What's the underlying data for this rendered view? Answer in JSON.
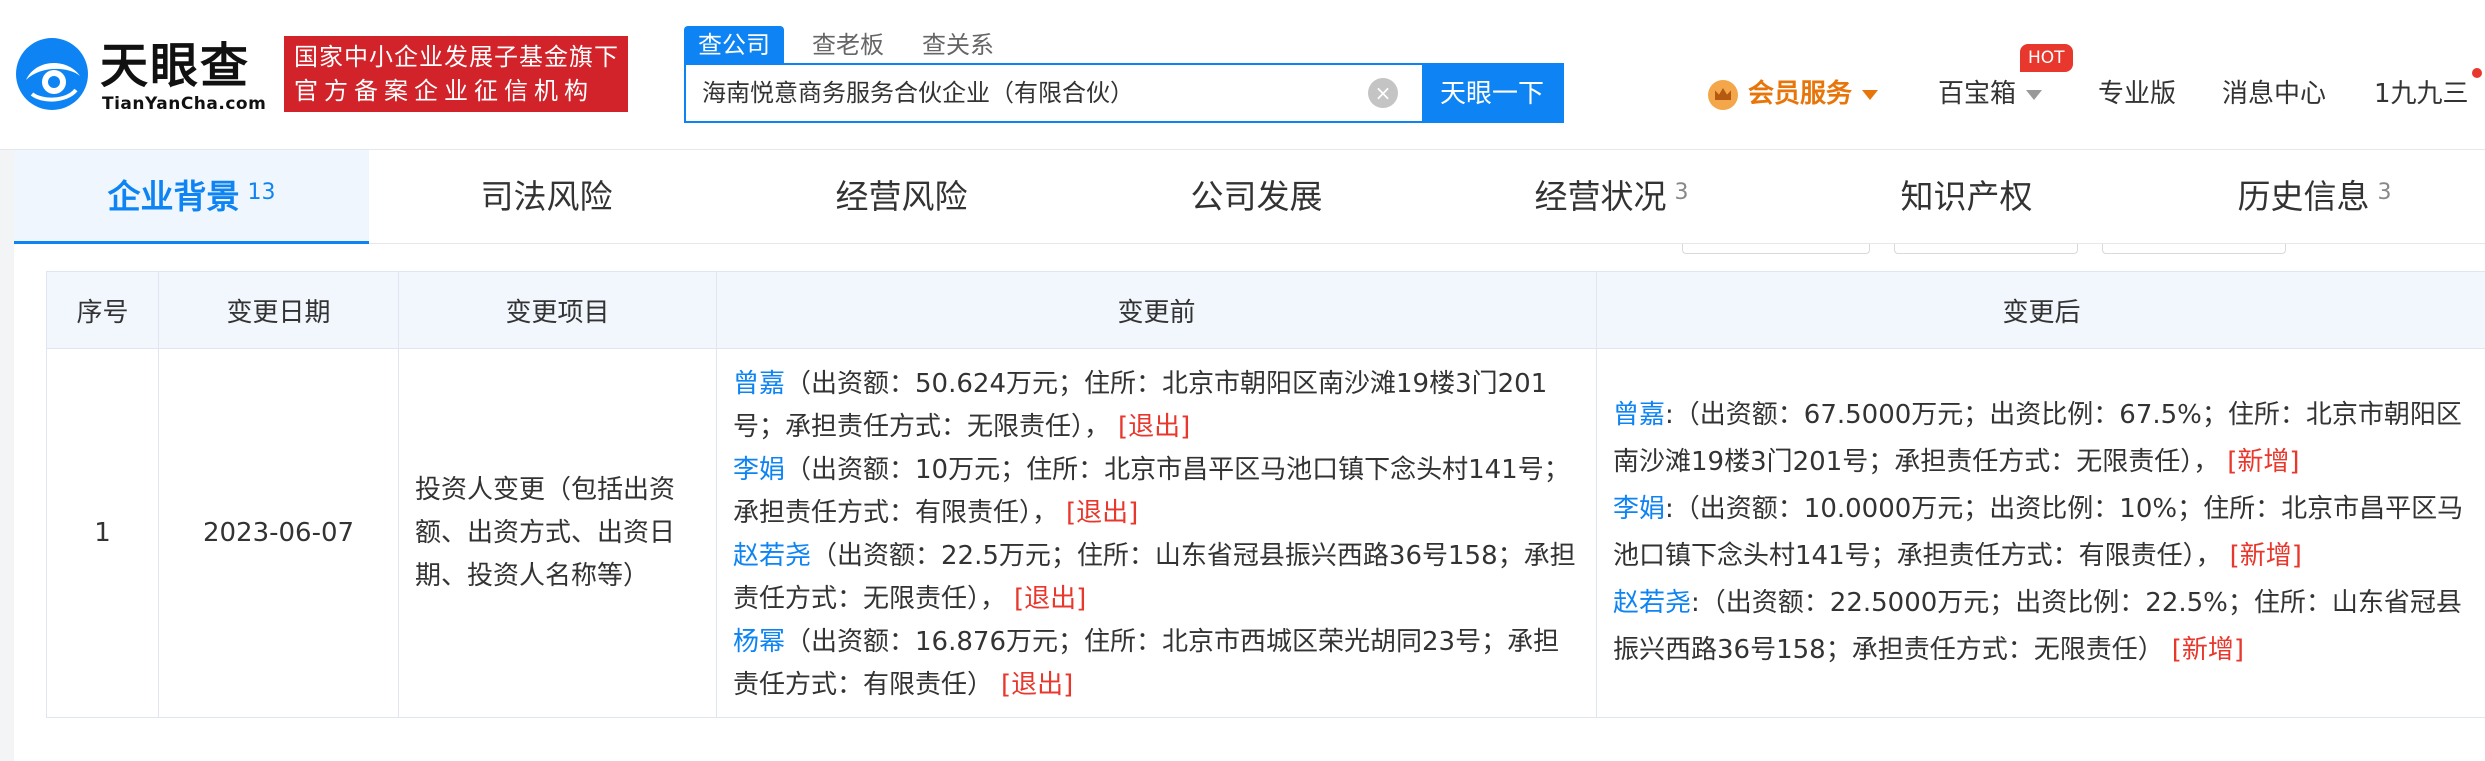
{
  "header": {
    "logo_text": "天眼查",
    "logo_sub": "TianYanCha.com",
    "badge_line1": "国家中小企业发展子基金旗下",
    "badge_line2": "官方备案企业征信机构",
    "search_tabs": [
      "查公司",
      "查老板",
      "查关系"
    ],
    "search_value": "海南悦意商务服务合伙企业（有限合伙）",
    "search_button": "天眼一下",
    "nav": {
      "vip": "会员服务",
      "treasure": "百宝箱",
      "hot": "HOT",
      "pro": "专业版",
      "messages": "消息中心",
      "user": "1九九三"
    }
  },
  "tabs": [
    {
      "label": "企业背景",
      "count": "13"
    },
    {
      "label": "司法风险",
      "count": ""
    },
    {
      "label": "经营风险",
      "count": ""
    },
    {
      "label": "公司发展",
      "count": ""
    },
    {
      "label": "经营状况",
      "count": "3"
    },
    {
      "label": "知识产权",
      "count": ""
    },
    {
      "label": "历史信息",
      "count": "3"
    }
  ],
  "table": {
    "headers": [
      "序号",
      "变更日期",
      "变更项目",
      "变更前",
      "变更后"
    ],
    "rows": [
      {
        "index": "1",
        "date": "2023-06-07",
        "item": "投资人变更（包括出资额、出资方式、出资日期、投资人名称等）",
        "before": [
          {
            "name": "曾嘉",
            "text": "（出资额：50.624万元；住所：北京市朝阳区南沙滩19楼3门201号；承担责任方式：无限责任），",
            "tag": "[退出]"
          },
          {
            "name": "李娟",
            "text": "（出资额：10万元；住所：北京市昌平区马池口镇下念头村141号；承担责任方式：有限责任），",
            "tag": "[退出]"
          },
          {
            "name": "赵若尧",
            "text": "（出资额：22.5万元；住所：山东省冠县振兴西路36号158；承担责任方式：无限责任），",
            "tag": "[退出]"
          },
          {
            "name": "杨幂",
            "text": "（出资额：16.876万元；住所：北京市西城区荣光胡同23号；承担责任方式：有限责任）",
            "tag": "[退出]"
          }
        ],
        "after": [
          {
            "name": "曾嘉",
            "text": ":（出资额：67.5000万元；出资比例：67.5%；住所：北京市朝阳区南沙滩19楼3门201号；承担责任方式：无限责任），",
            "tag": "[新增]"
          },
          {
            "name": "李娟",
            "text": ":（出资额：10.0000万元；出资比例：10%；住所：北京市昌平区马池口镇下念头村141号；承担责任方式：有限责任），",
            "tag": "[新增]"
          },
          {
            "name": "赵若尧",
            "text": ":（出资额：22.5000万元；出资比例：22.5%；住所：山东省冠县振兴西路36号158；承担责任方式：无限责任）",
            "tag": "[新增]"
          }
        ]
      }
    ]
  }
}
